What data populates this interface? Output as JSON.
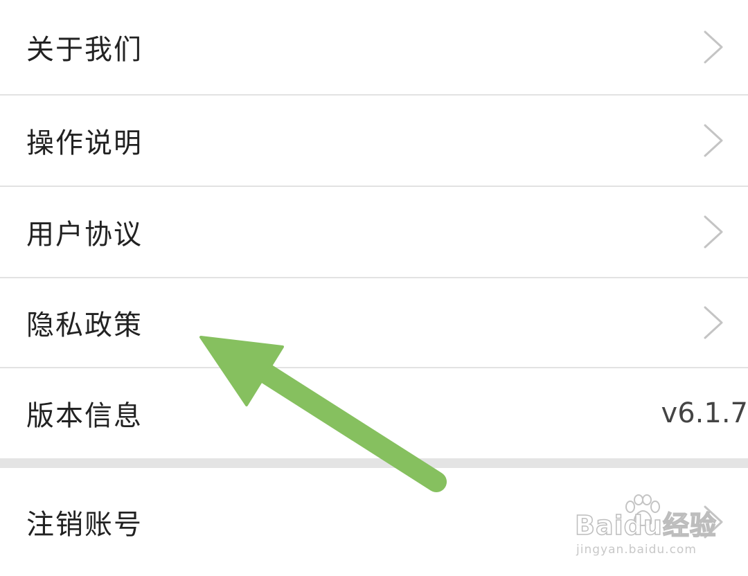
{
  "settings_list": {
    "items": [
      {
        "label": "关于我们",
        "has_chevron": true
      },
      {
        "label": "操作说明",
        "has_chevron": true
      },
      {
        "label": "用户协议",
        "has_chevron": true
      },
      {
        "label": "隐私政策",
        "has_chevron": true
      },
      {
        "label": "版本信息",
        "value": "v6.1.7",
        "has_chevron": false
      }
    ]
  },
  "account_section": {
    "items": [
      {
        "label": "注销账号",
        "has_chevron": true
      }
    ]
  },
  "annotation": {
    "arrow_color": "#86c05f",
    "arrow_target": "隐私政策"
  },
  "watermark": {
    "brand": "Baidu经验",
    "url": "jingyan.baidu.com"
  },
  "colors": {
    "background": "#ffffff",
    "label_text": "#222222",
    "divider": "#e2e2e2",
    "chevron": "#c4c4c4"
  }
}
